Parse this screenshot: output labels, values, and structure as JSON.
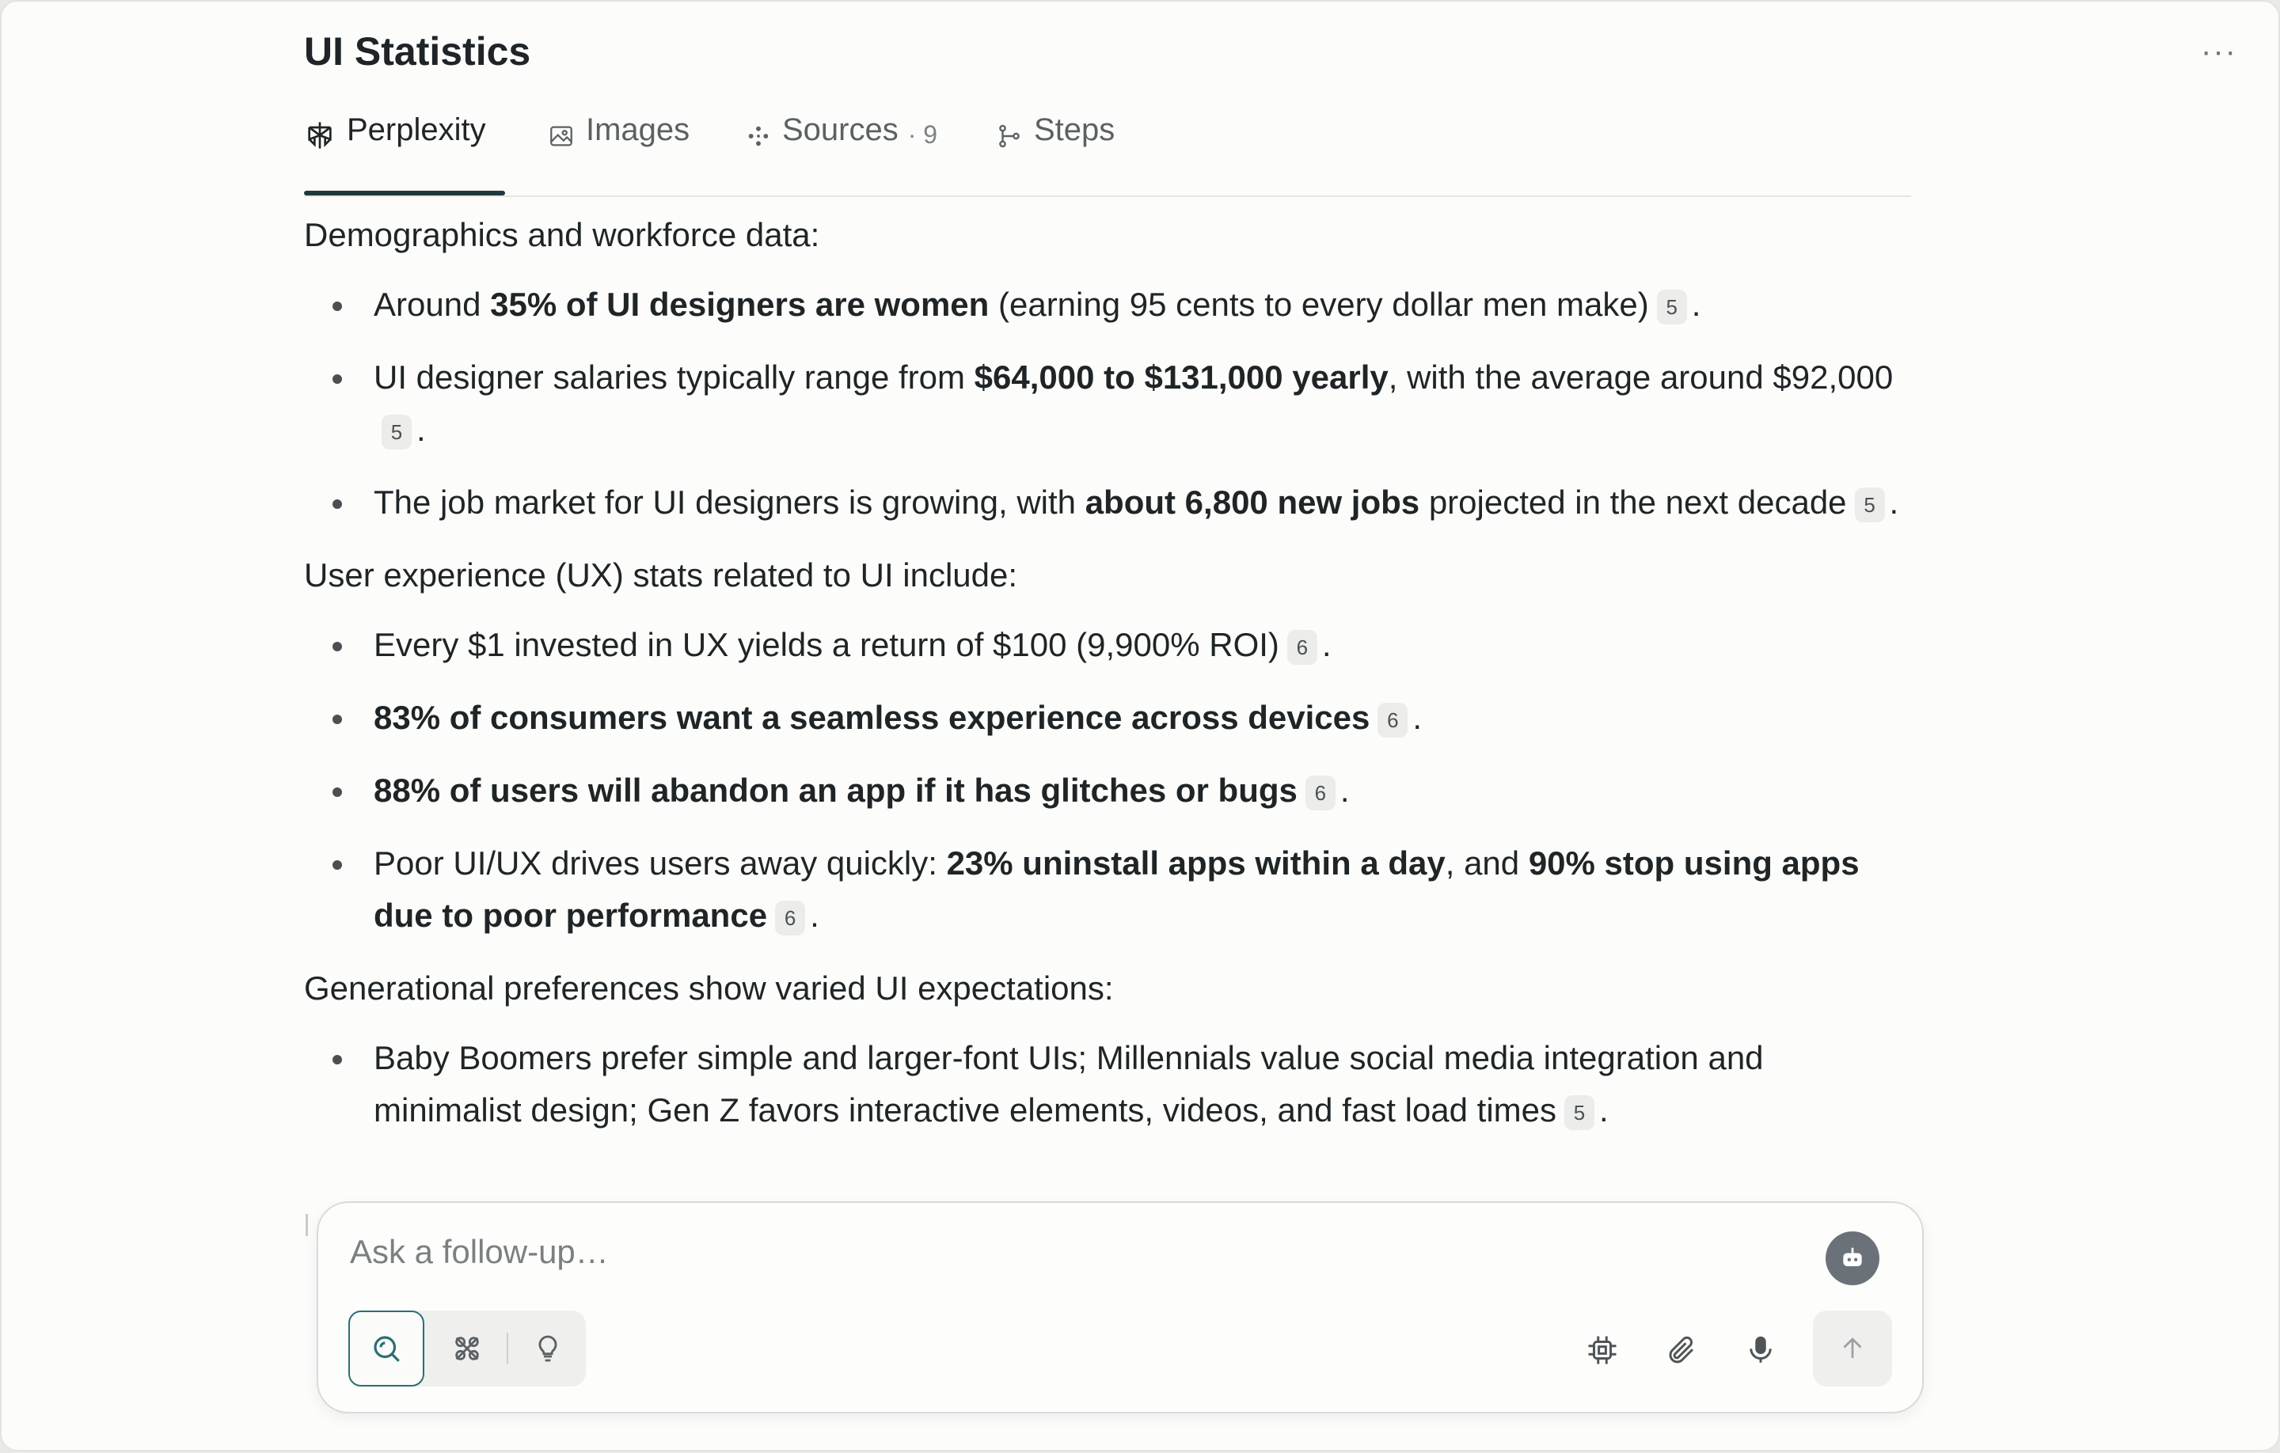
{
  "header": {
    "title": "UI Statistics",
    "more_label": "···"
  },
  "tabs": [
    {
      "label": "Perplexity",
      "icon": "perplexity-logo-icon",
      "active": true
    },
    {
      "label": "Images",
      "icon": "image-icon"
    },
    {
      "label": "Sources",
      "count": "· 9",
      "icon": "sources-icon"
    },
    {
      "label": "Steps",
      "icon": "steps-icon"
    }
  ],
  "answer": {
    "section1_lead": "Demographics and workforce data:",
    "s1_b1": {
      "pre": "Around ",
      "bold": "35% of UI designers are women",
      "post": " (earning 95 cents to every dollar men make)",
      "cite": "5",
      "end": "."
    },
    "s1_b2": {
      "pre": "UI designer salaries typically range from ",
      "bold": "$64,000 to $131,000 yearly",
      "post": ", with the average around $92,000",
      "cite": "5",
      "end": "."
    },
    "s1_b3": {
      "pre": "The job market for UI designers is growing, with ",
      "bold": "about 6,800 new jobs",
      "post": " projected in the next decade",
      "cite": "5",
      "end": "."
    },
    "section2_lead": "User experience (UX) stats related to UI include:",
    "s2_b1": {
      "pre": "Every $1 invested in UX yields a return of $100 (9,900% ROI)",
      "cite": "6",
      "end": "."
    },
    "s2_b2": {
      "bold": "83% of consumers want a seamless experience across devices",
      "cite": "6",
      "end": "."
    },
    "s2_b3": {
      "bold": "88% of users will abandon an app if it has glitches or bugs",
      "cite": "6",
      "end": "."
    },
    "s2_b4": {
      "pre": "Poor UI/UX drives users away quickly: ",
      "bold": "23% uninstall apps within a day",
      "mid": ", and ",
      "bold2": "90% stop using apps due to poor performance",
      "cite": "6",
      "end": "."
    },
    "section3_lead": "Generational preferences show varied UI expectations:",
    "s3_b1": {
      "pre": "Baby Boomers prefer simple and larger-font UIs; Millennials value social media integration and minimalist design; Gen Z favors interactive elements, videos, and fast load times",
      "cite": "5",
      "end": "."
    }
  },
  "composer": {
    "placeholder": "Ask a follow-up…",
    "modes": [
      "search-icon",
      "reasoning-icon",
      "research-lightbulb-icon"
    ],
    "tools": [
      "chip-icon",
      "paperclip-icon",
      "microphone-icon"
    ],
    "send_icon": "arrow-up-icon",
    "avatar_icon": "robot-icon"
  },
  "colors": {
    "accent": "#2a6f73",
    "tab_underline": "#20383c",
    "background": "#fcfcfb"
  }
}
